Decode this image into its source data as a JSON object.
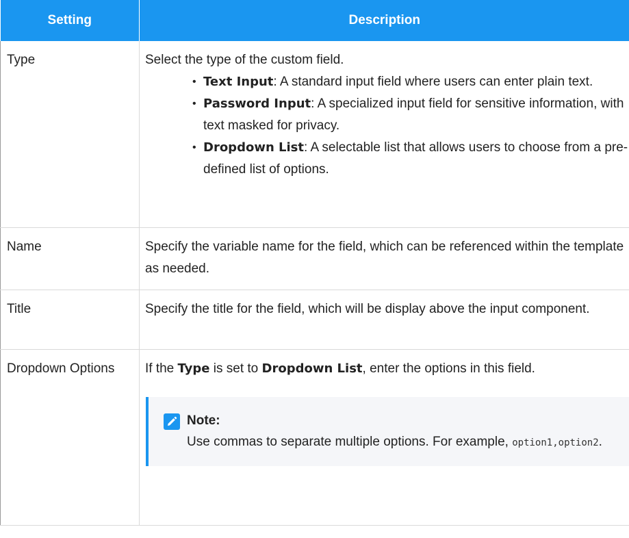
{
  "table": {
    "headers": [
      "Setting",
      "Description"
    ],
    "rows": {
      "type": {
        "setting": "Type",
        "intro": "Select the type of the custom field.",
        "items": [
          {
            "term": "Text Input",
            "desc": ": A standard input field where users can enter plain text."
          },
          {
            "term": "Password Input",
            "desc": ": A specialized input field for sensitive information, with text masked for privacy."
          },
          {
            "term": "Dropdown List",
            "desc": ": A selectable list that allows users to choose from a pre-defined list of options."
          }
        ]
      },
      "name": {
        "setting": "Name",
        "desc": "Specify the variable name for the field, which can be referenced within the template as needed."
      },
      "title": {
        "setting": "Title",
        "desc": "Specify the title for the field, which will be display above the input component."
      },
      "dropdown": {
        "setting": "Dropdown Options",
        "desc_pre": "If the ",
        "desc_bold1": "Type",
        "desc_mid": " is set to ",
        "desc_bold2": "Dropdown List",
        "desc_post": ", enter the options in this field.",
        "note": {
          "title": "Note:",
          "body": "Use commas to separate multiple options. For example, ",
          "code": "option1,option2",
          "end": ".",
          "icon": "edit-note-icon"
        }
      }
    }
  },
  "colors": {
    "header_bg": "#1a96f0",
    "note_bg": "#f5f6f9",
    "accent": "#1a96f0"
  }
}
